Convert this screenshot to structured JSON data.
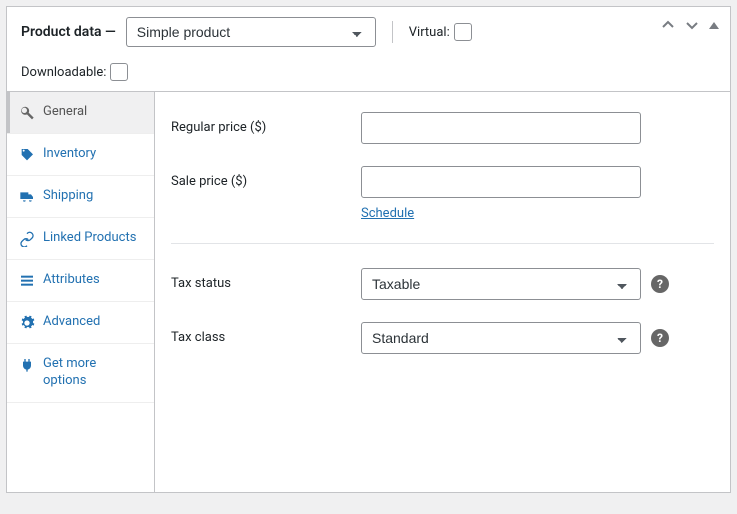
{
  "header": {
    "title": "Product data —",
    "product_type": "Simple product",
    "virtual_label": "Virtual:",
    "downloadable_label": "Downloadable:"
  },
  "tabs": [
    {
      "label": "General"
    },
    {
      "label": "Inventory"
    },
    {
      "label": "Shipping"
    },
    {
      "label": "Linked Products"
    },
    {
      "label": "Attributes"
    },
    {
      "label": "Advanced"
    },
    {
      "label": "Get more options"
    }
  ],
  "fields": {
    "regular_price_label": "Regular price ($)",
    "regular_price_value": "",
    "sale_price_label": "Sale price ($)",
    "sale_price_value": "",
    "schedule_link": "Schedule",
    "tax_status_label": "Tax status",
    "tax_status_value": "Taxable",
    "tax_class_label": "Tax class",
    "tax_class_value": "Standard"
  }
}
